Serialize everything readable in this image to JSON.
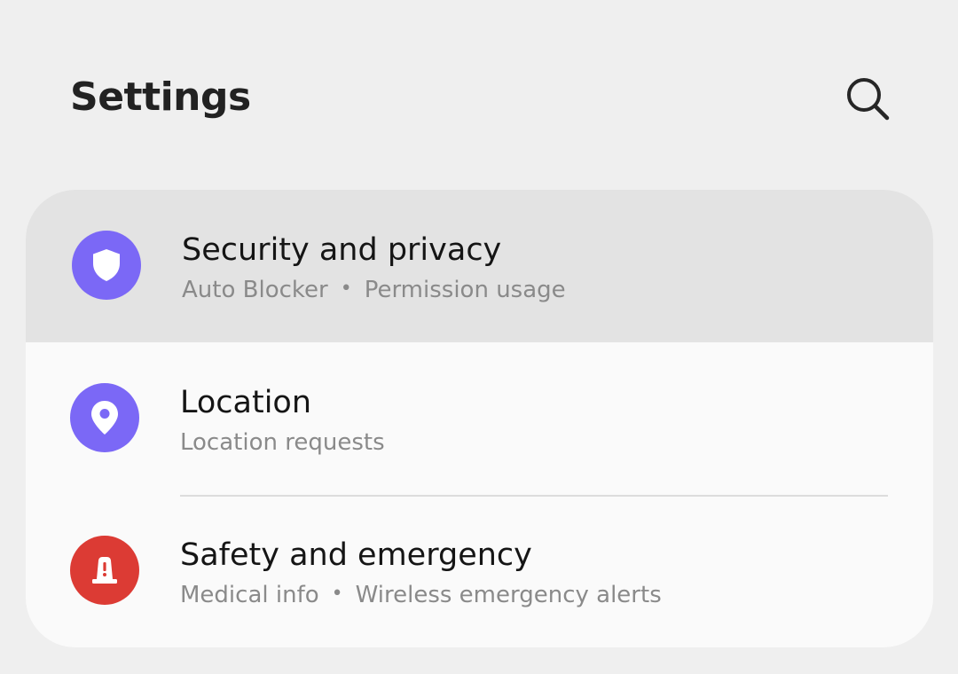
{
  "header": {
    "title": "Settings",
    "search_icon": "search-icon"
  },
  "items": [
    {
      "title": "Security and privacy",
      "subtitle_parts": [
        "Auto Blocker",
        "Permission usage"
      ],
      "icon": "shield-icon",
      "icon_color": "#7b68f6",
      "highlighted": true
    },
    {
      "title": "Location",
      "subtitle_parts": [
        "Location requests"
      ],
      "icon": "location-pin-icon",
      "icon_color": "#7b68f6",
      "highlighted": false
    },
    {
      "title": "Safety and emergency",
      "subtitle_parts": [
        "Medical info",
        "Wireless emergency alerts"
      ],
      "icon": "emergency-siren-icon",
      "icon_color": "#dc3b34",
      "highlighted": false
    }
  ],
  "separator": "•",
  "colors": {
    "background": "#efefef",
    "card": "#fafafa",
    "highlight": "#e3e3e3",
    "accent_purple": "#7b68f6",
    "accent_red": "#dc3b34"
  }
}
